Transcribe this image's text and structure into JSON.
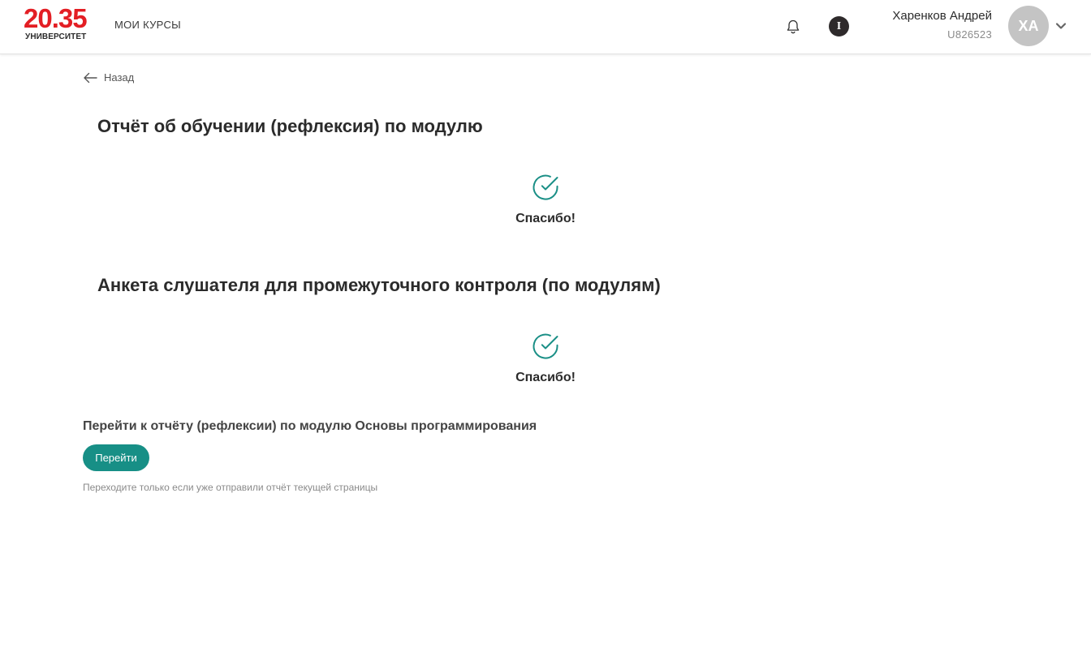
{
  "header": {
    "logo": {
      "number": "20.35",
      "subtitle": "УНИВЕРСИТЕТ"
    },
    "nav_courses": "МОИ КУРСЫ",
    "info_badge": "I",
    "user": {
      "name": "Харенков Андрей",
      "id": "U826523",
      "initials": "ХА"
    }
  },
  "back": {
    "label": "Назад"
  },
  "sections": [
    {
      "title": "Отчёт об обучении (рефлексия) по модулю",
      "status": "Спасибо!"
    },
    {
      "title": "Анкета слушателя для промежуточного контроля (по модулям)",
      "status": "Спасибо!"
    }
  ],
  "next": {
    "text": "Перейти к отчёту (рефлексии) по модулю Основы программирования",
    "button": "Перейти",
    "hint": "Переходите только если уже отправили отчёт текущей страницы"
  },
  "colors": {
    "brand_red": "#e31e24",
    "accent_teal": "#178f86",
    "check_teal": "#1a8f86",
    "avatar_gray": "#c4c4c4"
  },
  "icons": [
    "bell-icon",
    "info-icon",
    "chevron-down-icon",
    "arrow-left-icon",
    "check-circle-icon"
  ]
}
